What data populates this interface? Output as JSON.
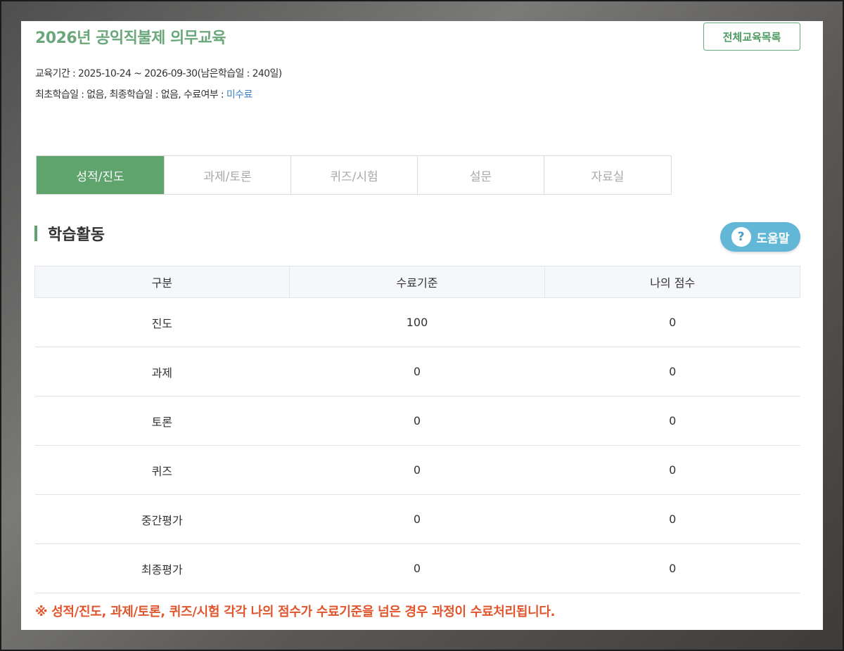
{
  "course": {
    "title": "2026년 공익직불제 의무교육",
    "all_list_button": "전체교육목록",
    "period_text": "교육기간 : 2025-10-24 ~ 2026-09-30(남은학습일 : 240일)",
    "history_text": "최초학습일 : 없음, 최종학습일 : 없음, 수료여부 : ",
    "completion_status": "미수료"
  },
  "tabs": [
    {
      "label": "성적/진도",
      "active": true
    },
    {
      "label": "과제/토론",
      "active": false
    },
    {
      "label": "퀴즈/시험",
      "active": false
    },
    {
      "label": "설문",
      "active": false
    },
    {
      "label": "자료실",
      "active": false
    }
  ],
  "section": {
    "title": "학습활동",
    "help_button": "도움말",
    "help_icon_glyph": "?"
  },
  "table": {
    "headers": [
      "구분",
      "수료기준",
      "나의 점수"
    ],
    "rows": [
      [
        "진도",
        "100",
        "0"
      ],
      [
        "과제",
        "0",
        "0"
      ],
      [
        "토론",
        "0",
        "0"
      ],
      [
        "퀴즈",
        "0",
        "0"
      ],
      [
        "중간평가",
        "0",
        "0"
      ],
      [
        "최종평가",
        "0",
        "0"
      ]
    ]
  },
  "notice": "※ 성적/진도, 과제/토론, 퀴즈/시험 각각 나의 점수가 수료기준을 넘은 경우 과정이 수료처리됩니다.",
  "colors": {
    "accent_green": "#5fa46d",
    "help_blue": "#62b6d6",
    "notice_red": "#e0552c",
    "link_blue": "#3b7fc4"
  }
}
